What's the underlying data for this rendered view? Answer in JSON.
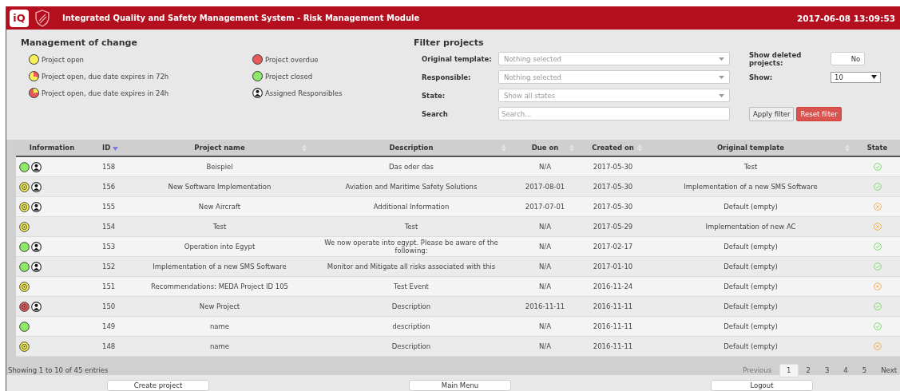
{
  "header": {
    "logo": "iQ",
    "title": "Integrated Quality and Safety Management System - Risk Management Module",
    "datetime": "2017-06-08 13:09:53"
  },
  "legend": {
    "title": "Management of change",
    "items": [
      {
        "kind": "open",
        "label": "Project open"
      },
      {
        "kind": "open72",
        "label": "Project open, due date expires in 72h"
      },
      {
        "kind": "open24",
        "label": "Project open, due date expires in 24h"
      },
      {
        "kind": "overdue",
        "label": "Project overdue"
      },
      {
        "kind": "closed",
        "label": "Project closed"
      },
      {
        "kind": "responsible",
        "label": "Assigned Responsibles"
      }
    ]
  },
  "filter": {
    "title": "Filter projects",
    "fields": [
      {
        "label": "Original template:",
        "kind": "select",
        "placeholder": "Nothing selected"
      },
      {
        "label": "Responsible:",
        "kind": "select",
        "placeholder": "Nothing selected"
      },
      {
        "label": "State:",
        "kind": "select",
        "placeholder": "Show all states"
      },
      {
        "label": "Search",
        "kind": "text",
        "placeholder": "Search..."
      }
    ],
    "show_deleted": {
      "label": "Show deleted projects:",
      "value": "No",
      "on": false
    },
    "show": {
      "label": "Show:",
      "value": "10"
    },
    "buttons": [
      {
        "label": "Apply filter",
        "kind": "default"
      },
      {
        "label": "Reset filter",
        "kind": "danger"
      }
    ]
  },
  "table": {
    "columns": [
      {
        "label": "Information",
        "kind": "plain"
      },
      {
        "label": "ID",
        "kind": "sorted"
      },
      {
        "label": "Project name",
        "kind": "sortable"
      },
      {
        "label": "Description",
        "kind": "sortable"
      },
      {
        "label": "Due on",
        "kind": "sortable"
      },
      {
        "label": "Created on",
        "kind": "sortable"
      },
      {
        "label": "Original template",
        "kind": "sortable"
      },
      {
        "label": "State",
        "kind": "plain"
      }
    ],
    "rows": [
      {
        "icons": [
          {
            "kind": "closed"
          },
          {
            "kind": "responsible"
          }
        ],
        "id": "158",
        "name": "Beispiel",
        "description": "Das oder das",
        "due": "N/A",
        "created": "2017-05-30",
        "template": "Test",
        "state": {
          "kind": "done"
        }
      },
      {
        "icons": [
          {
            "kind": "open"
          },
          {
            "kind": "responsible"
          }
        ],
        "id": "156",
        "name": "New Software Implementation",
        "description": "Aviation and Maritime Safety Solutions",
        "due": "2017-08-01",
        "created": "2017-05-30",
        "template": "Implementation of a new SMS Software",
        "state": {
          "kind": "done"
        }
      },
      {
        "icons": [
          {
            "kind": "open"
          },
          {
            "kind": "responsible"
          }
        ],
        "id": "155",
        "name": "New Aircraft",
        "description": "Additional Information",
        "due": "2017-07-01",
        "created": "2017-05-30",
        "template": "Default (empty)",
        "state": {
          "kind": "cancelled"
        }
      },
      {
        "icons": [
          {
            "kind": "open"
          }
        ],
        "id": "154",
        "name": "Test",
        "description": "Test",
        "due": "N/A",
        "created": "2017-05-29",
        "template": "Implementation of new AC",
        "state": {
          "kind": "cancelled"
        }
      },
      {
        "icons": [
          {
            "kind": "closed"
          },
          {
            "kind": "responsible"
          }
        ],
        "id": "153",
        "name": "Operation into Egypt",
        "description": "We now operate into egypt. Please be aware of the following:",
        "due": "N/A",
        "created": "2017-02-17",
        "template": "Default (empty)",
        "state": {
          "kind": "done"
        }
      },
      {
        "icons": [
          {
            "kind": "closed"
          },
          {
            "kind": "responsible"
          }
        ],
        "id": "152",
        "name": "Implementation of a new SMS Software",
        "description": "Monitor and Mitigate all risks associated with this",
        "due": "N/A",
        "created": "2017-01-10",
        "template": "Default (empty)",
        "state": {
          "kind": "done"
        }
      },
      {
        "icons": [
          {
            "kind": "open"
          }
        ],
        "id": "151",
        "name": "Recommendations: MEDA Project ID 105",
        "description": "Test Event",
        "due": "N/A",
        "created": "2016-11-24",
        "template": "Default (empty)",
        "state": {
          "kind": "cancelled"
        }
      },
      {
        "icons": [
          {
            "kind": "overdue"
          },
          {
            "kind": "responsible"
          }
        ],
        "id": "150",
        "name": "New Project",
        "description": "Description",
        "due": "2016-11-11",
        "created": "2016-11-11",
        "template": "Default (empty)",
        "state": {
          "kind": "done"
        }
      },
      {
        "icons": [
          {
            "kind": "closed"
          }
        ],
        "id": "149",
        "name": "name",
        "description": "description",
        "due": "N/A",
        "created": "2016-11-11",
        "template": "Default (empty)",
        "state": {
          "kind": "done"
        }
      },
      {
        "icons": [
          {
            "kind": "open"
          }
        ],
        "id": "148",
        "name": "name",
        "description": "Description",
        "due": "N/A",
        "created": "2016-11-11",
        "template": "Default (empty)",
        "state": {
          "kind": "cancelled"
        }
      }
    ]
  },
  "footer": {
    "info": "Showing 1 to 10 of 45 entries",
    "previous": "Previous",
    "pages": [
      {
        "label": "1",
        "selected": true
      },
      {
        "label": "2",
        "selected": false
      },
      {
        "label": "3",
        "selected": false
      },
      {
        "label": "4",
        "selected": false
      },
      {
        "label": "5",
        "selected": false
      }
    ],
    "next": "Next"
  },
  "actions": [
    "Create project",
    "Main Menu",
    "Logout"
  ]
}
